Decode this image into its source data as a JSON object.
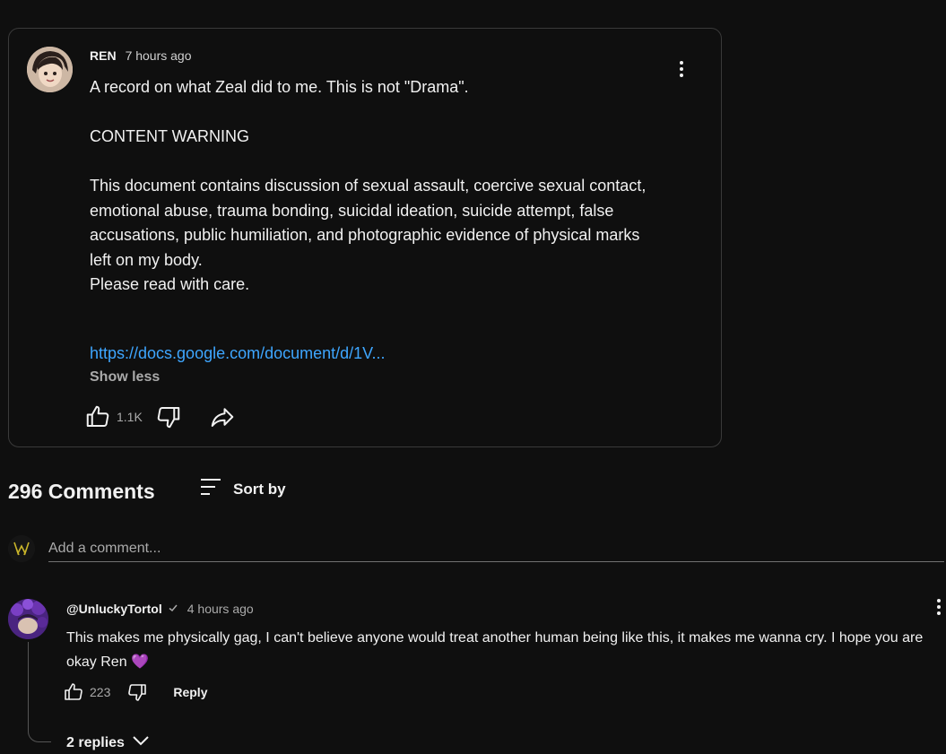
{
  "post": {
    "author": "REN",
    "time": "7 hours ago",
    "lines": [
      "A record on what Zeal did to me. This is not \"Drama\".",
      "",
      "CONTENT WARNING",
      "",
      "This document contains discussion of sexual assault, coercive sexual contact, emotional abuse, trauma bonding, suicidal ideation, suicide attempt, false accusations, public humiliation, and photographic evidence of physical marks left on my body.",
      "Please read with care."
    ],
    "link": "https://docs.google.com/document/d/1V...",
    "show_less": "Show less",
    "like_count": "1.1K"
  },
  "comments_header": {
    "count_label": "296 Comments",
    "sort_label": "Sort by"
  },
  "add_comment": {
    "placeholder": "Add a comment..."
  },
  "comment": {
    "author": "@UnluckyTortol",
    "time": "4 hours ago",
    "text": "This makes me physically gag, I can't believe anyone would treat another human being like this, it makes me wanna cry. I hope you are okay Ren 💜",
    "like_count": "223",
    "reply_label": "Reply",
    "replies_label": "2 replies"
  },
  "colors": {
    "background": "#0f0f0f",
    "link": "#3ea6ff",
    "muted": "#aaaaaa"
  },
  "icons": [
    "more-vert-icon",
    "thumb-up-icon",
    "thumb-down-icon",
    "share-icon",
    "sort-icon",
    "checkmark-icon",
    "chevron-down-icon"
  ]
}
